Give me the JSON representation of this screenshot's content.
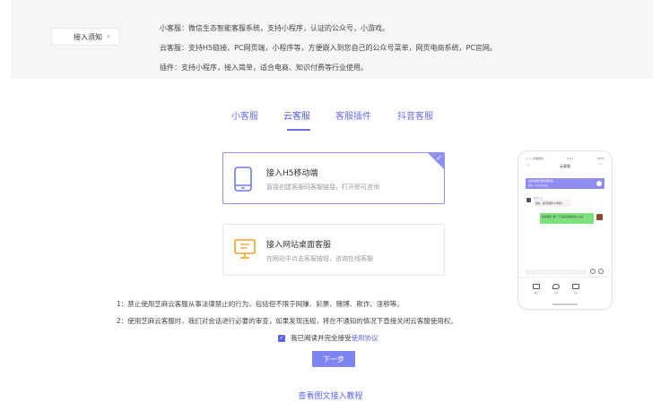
{
  "notice": {
    "tag_label": "接入须知",
    "tag_close": "×",
    "lines": [
      "小客服：微信生态智能客服系统，支持小程序，认证的公众号，小游戏。",
      "云客服：支持H5链接、PC网页端，小程序等，方便嵌入到您自己的公众号菜单，网页电商系统，PC官网。",
      "插件：支持小程序，接入简单，适合电商、知识付费等行业使用。"
    ]
  },
  "tabs": [
    {
      "label": "小客服"
    },
    {
      "label": "云客服"
    },
    {
      "label": "客服插件"
    },
    {
      "label": "抖音客服"
    }
  ],
  "active_tab": "云客服",
  "cards": [
    {
      "title": "接入H5移动端",
      "subtitle": "直接创建客服码客服链接，打开即可咨询",
      "icon": "mobile-icon",
      "selected": true
    },
    {
      "title": "接入网站桌面客服",
      "subtitle": "在网站中点击客服按钮，咨询在线客服",
      "icon": "monitor-icon",
      "selected": false
    }
  ],
  "rules": [
    "1：禁止使用芝麻云客服从事法律禁止的行为，包括但不限于网赚、彩票、赌博、欺诈、淫秽等。",
    "2：使用芝麻云客服时，我们对会话进行必要的审查，如果发现违规，将在不通知的情况下直接关闭云客服使用权。"
  ],
  "agree": {
    "checked": true,
    "text": "我已阅读并完全接受",
    "link": "使用协议"
  },
  "next_button": "下一步",
  "tutorial_link": "查看图文接入教程",
  "phone_preview": {
    "status_left": "•••• 中国移动",
    "status_time": "9:41",
    "status_right": "100%",
    "title": "云客服",
    "banner_title": "欢迎使用智能客服系统",
    "banner_sub": "客服 · 在线为您服务",
    "agent_name": "客服小芝",
    "agent_msg": "您好，请问需要什么帮助？",
    "user_msg": "您好我想了解一下芝麻云客服的接入方式",
    "tools": [
      "图片",
      "位置",
      "评价"
    ]
  },
  "colors": {
    "accent": "#6b6ef2",
    "button": "#7d84f0",
    "notice_bg": "#f6f6f8",
    "link": "#5b66e6"
  }
}
